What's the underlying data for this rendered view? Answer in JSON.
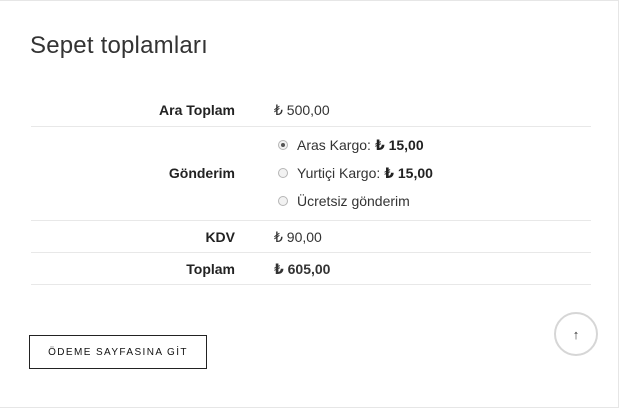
{
  "title": "Sepet toplamları",
  "rows": {
    "subtotal": {
      "label": "Ara Toplam",
      "value": "₺ 500,00"
    },
    "shipping": {
      "label": "Gönderim",
      "options": [
        {
          "name": "Aras Kargo:",
          "price": "₺ 15,00",
          "checked": true
        },
        {
          "name": "Yurtiçi Kargo:",
          "price": "₺ 15,00",
          "checked": false
        },
        {
          "name": "Ücretsiz gönderim",
          "price": "",
          "checked": false
        }
      ]
    },
    "tax": {
      "label": "KDV",
      "value": "₺ 90,00"
    },
    "total": {
      "label": "Toplam",
      "value": "₺ 605,00"
    }
  },
  "checkout_button": "ÖDEME SAYFASINA GİT",
  "scroll_top_icon": "↑"
}
